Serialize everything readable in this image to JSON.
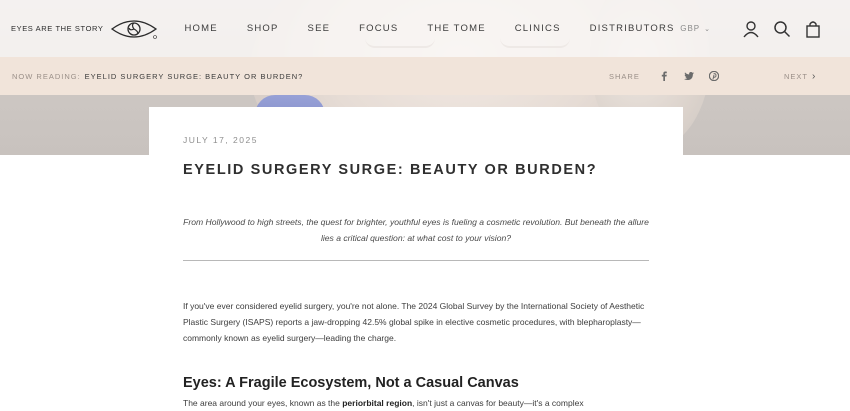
{
  "header": {
    "brand": "EYES ARE THE STORY",
    "nav": [
      "HOME",
      "SHOP",
      "SEE",
      "FOCUS",
      "THE TOME",
      "CLINICS",
      "DISTRIBUTORS"
    ],
    "currency": "GBP",
    "icons": [
      "account-icon",
      "search-icon",
      "bag-icon"
    ]
  },
  "reading_bar": {
    "label": "NOW READING:",
    "title": "EYELID SURGERY SURGE: BEAUTY OR BURDEN?",
    "share_label": "SHARE",
    "social_icons": [
      "facebook-icon",
      "twitter-icon",
      "pinterest-icon"
    ],
    "next_label": "NEXT"
  },
  "article": {
    "date": "JULY 17, 2025",
    "title": "EYELID SURGERY SURGE: BEAUTY OR BURDEN?",
    "intro": "From Hollywood to high streets, the quest for brighter, youthful eyes is fueling a cosmetic revolution. But beneath the allure lies a critical question: at what cost to your vision?",
    "paragraph_1": "If you've ever considered eyelid surgery, you're not alone. The 2024 Global Survey by the International Society of Aesthetic Plastic Surgery (ISAPS) reports a jaw-dropping 42.5% global spike in elective cosmetic procedures, with blepharoplasty—commonly known as eyelid surgery—leading the charge.",
    "heading_2": "Eyes: A Fragile Ecosystem, Not a Casual Canvas",
    "paragraph_2_pre": "The area around your eyes, known as the ",
    "paragraph_2_bold": "periorbital region",
    "paragraph_2_post": ", isn't just a canvas for beauty—it's a complex"
  },
  "colors": {
    "reading_bar_bg": "#f1e4da",
    "header_bg": "#faf8f6",
    "text_dark": "#2f2f2f"
  }
}
